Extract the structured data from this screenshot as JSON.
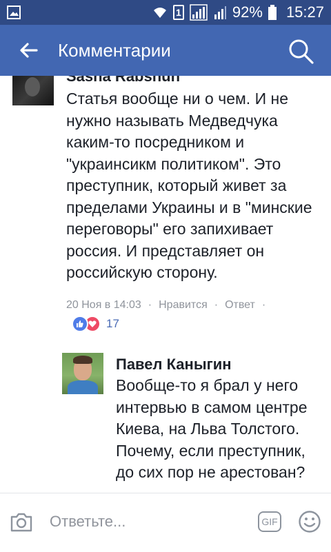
{
  "status_bar": {
    "battery_percent": "92%",
    "time": "15:27",
    "sim_slot": "1"
  },
  "header": {
    "title": "Комментарии",
    "back_icon": "back-arrow-icon",
    "search_icon": "search-icon"
  },
  "comments": [
    {
      "author": "Sasha Rabshun",
      "text": "Статья вообще ни о чем. И не нужно называть Медведчука каким-то посредником и \"украинсикм политиком\". Это преступник, который живет за пределами Украины и в \"минские переговоры\" его запихивает россия. И представляет он российскую сторону.",
      "timestamp": "20 Ноя в 14:03",
      "like_label": "Нравится",
      "reply_label": "Ответ",
      "separator": "·",
      "reaction_count": "17"
    }
  ],
  "reply": {
    "author": "Павел Каныгин",
    "text": "Вообще-то я брал у него интервью в самом центре Киева, на Льва Толстого. Почему, если преступник, до сих пор не арестован?"
  },
  "composer": {
    "placeholder": "Ответьте...",
    "gif_label": "GIF"
  },
  "colors": {
    "status_bar": "#2f4a85",
    "app_bar": "#4267b2",
    "like": "#4f7ce8",
    "love": "#ee4b65"
  }
}
